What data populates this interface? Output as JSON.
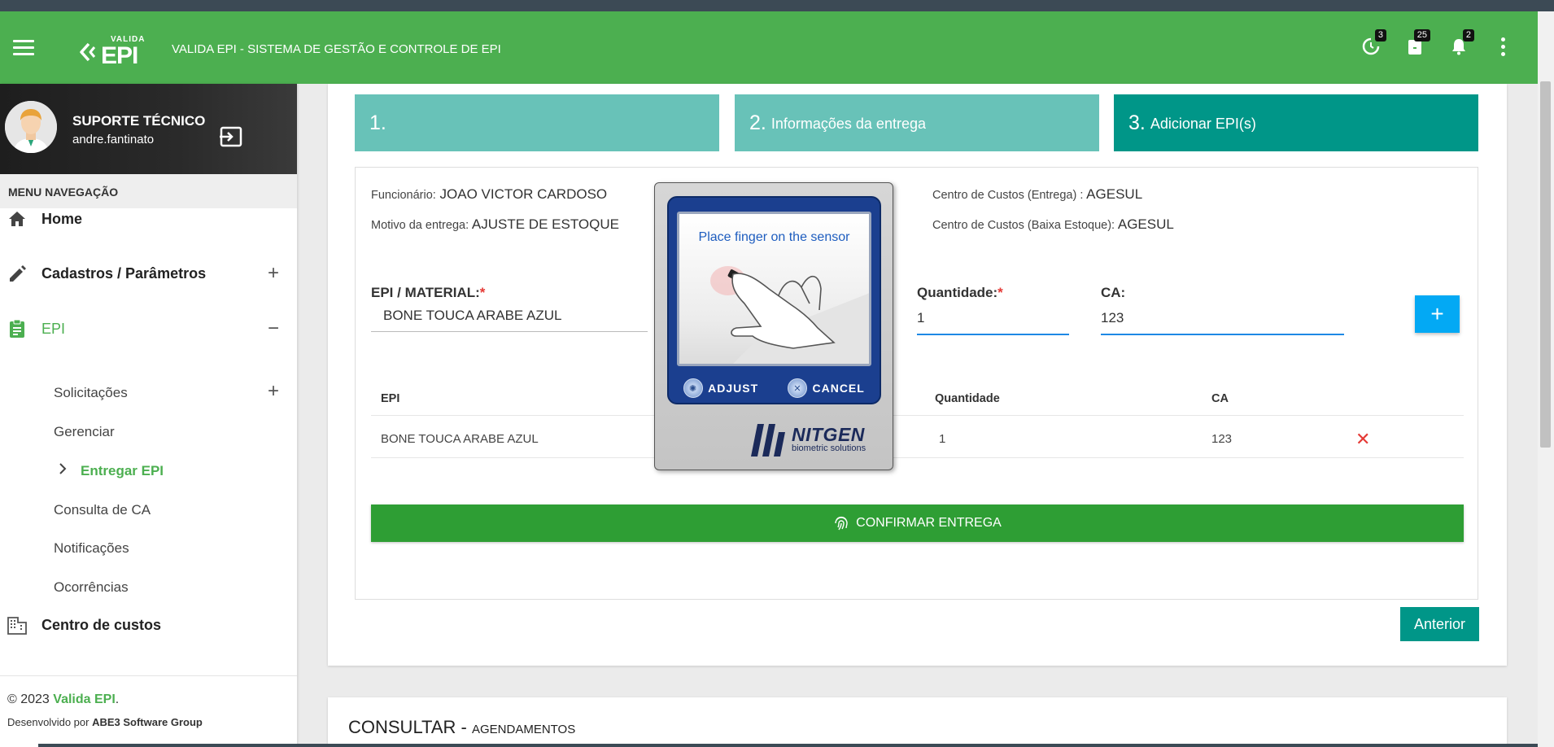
{
  "header": {
    "logo_small": "VALIDA",
    "logo_big": "EPI",
    "title": "VALIDA EPI - SISTEMA DE GESTÃO E CONTROLE DE EPI",
    "badges": {
      "history": "3",
      "tasks": "25",
      "notifications": "2"
    }
  },
  "user": {
    "name": "SUPORTE TÉCNICO",
    "login": "andre.fantinato"
  },
  "sidebar": {
    "menu_header": "MENU NAVEGAÇÃO",
    "items": [
      {
        "label": "Home"
      },
      {
        "label": "Cadastros / Parâmetros",
        "toggle": "+"
      },
      {
        "label": "EPI",
        "toggle": "−"
      },
      {
        "label": "Centro de custos"
      }
    ],
    "epi_sub": [
      {
        "label": "Solicitações",
        "toggle": "+"
      },
      {
        "label": "Gerenciar"
      },
      {
        "label": "Entregar EPI",
        "active": true
      },
      {
        "label": "Consulta de CA"
      },
      {
        "label": "Notificações"
      },
      {
        "label": "Ocorrências"
      }
    ],
    "footer": {
      "copyright_prefix": "© 2023 ",
      "copyright_brand": "Valida EPI",
      "copyright_suffix": ".",
      "dev_prefix": "Desenvolvido por ",
      "dev_company": "ABE3 Software Group"
    }
  },
  "steps": [
    {
      "num": "1.",
      "label": ""
    },
    {
      "num": "2.",
      "label": "Informações da entrega"
    },
    {
      "num": "3.",
      "label": "Adicionar EPI(s)"
    }
  ],
  "delivery": {
    "employee_label": "Funcionário:",
    "employee": "JOAO VICTOR CARDOSO",
    "reason_label": "Motivo da entrega:",
    "reason": "AJUSTE DE ESTOQUE",
    "cost_center_delivery_label": "Centro de Custos (Entrega) :",
    "cost_center_delivery": "AGESUL",
    "cost_center_stock_label": "Centro de Custos (Baixa Estoque):",
    "cost_center_stock": "AGESUL"
  },
  "form": {
    "material_label": "EPI / MATERIAL:",
    "material_value": "BONE TOUCA ARABE AZUL",
    "quantity_label": "Quantidade:",
    "quantity_value": "1",
    "ca_label": "CA:",
    "ca_value": "123",
    "add_label": "+"
  },
  "table": {
    "headers": {
      "epi": "EPI",
      "quantity": "Quantidade",
      "ca": "CA"
    },
    "rows": [
      {
        "epi": "BONE TOUCA ARABE AZUL",
        "quantity": "1",
        "ca": "123"
      }
    ]
  },
  "actions": {
    "confirm": "CONFIRMAR ENTREGA",
    "previous": "Anterior",
    "delete": "✕"
  },
  "consult": {
    "title": "CONSULTAR - ",
    "subtitle": "AGENDAMENTOS"
  },
  "fingerprint": {
    "message": "Place finger on the sensor",
    "adjust": "ADJUST",
    "cancel": "CANCEL",
    "brand": "NITGEN",
    "brand_sub": "biometric solutions"
  },
  "colors": {
    "primary_green": "#4caf50",
    "teal": "#009688",
    "teal_light": "#68c2b8",
    "confirm_green": "#2e9e34",
    "add_blue": "#03a9f4",
    "danger": "#e53935"
  }
}
